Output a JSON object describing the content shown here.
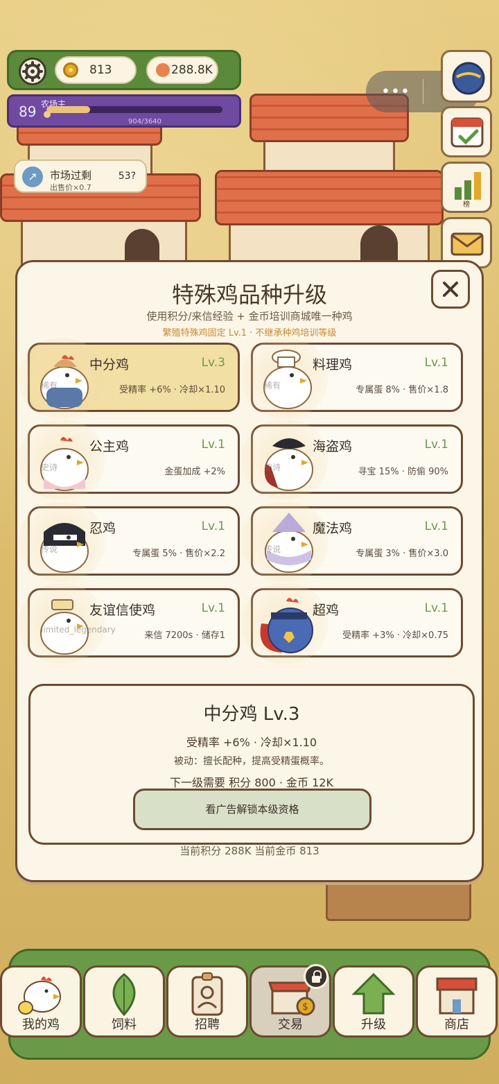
{
  "hud": {
    "coins": "813",
    "seeds": "288.8K",
    "level": "89",
    "level_title": "农场主",
    "xp_text": "904/3640",
    "xp_fraction": 0.248
  },
  "market": {
    "title": "市场过剩",
    "sub": "出售价×0.7",
    "count": "53?"
  },
  "side": {
    "rank_label": "榜"
  },
  "modal": {
    "title": "特殊鸡品种升级",
    "subtitle": "使用积分/来信经验 + 金币培训商城唯一种鸡",
    "note": "繁殖特殊鸡固定 Lv.1 · 不继承种鸡培训等级",
    "cards": [
      {
        "name": "中分鸡",
        "lv": "Lv.3",
        "stats": "受精率 +6% · 冷却×1.10",
        "tag": "稀有"
      },
      {
        "name": "料理鸡",
        "lv": "Lv.1",
        "stats": "专属蛋 8% · 售价×1.8",
        "tag": "稀有"
      },
      {
        "name": "公主鸡",
        "lv": "Lv.1",
        "stats": "金蛋加成 +2%",
        "tag": "史诗"
      },
      {
        "name": "海盗鸡",
        "lv": "Lv.1",
        "stats": "寻宝 15% · 防偷 90%",
        "tag": "史诗"
      },
      {
        "name": "忍鸡",
        "lv": "Lv.1",
        "stats": "专属蛋 5% · 售价×2.2",
        "tag": "传说"
      },
      {
        "name": "魔法鸡",
        "lv": "Lv.1",
        "stats": "专属蛋 3% · 售价×3.0",
        "tag": "传说"
      },
      {
        "name": "友谊信使鸡",
        "lv": "Lv.1",
        "stats": "来信 7200s · 储存1",
        "tag": "limited_legendary"
      },
      {
        "name": "超鸡",
        "lv": "Lv.1",
        "stats": "受精率 +3% · 冷却×0.75",
        "tag": ""
      }
    ],
    "detail": {
      "title": "中分鸡  Lv.3",
      "stats": "受精率 +6% · 冷却×1.10",
      "passive": "被动：擅长配种，提高受精蛋概率。",
      "next": "下一级需要  积分 800  ·  金币 12K",
      "ad_button": "看广告解锁本级资格"
    },
    "balance": "当前积分 288K   当前金币 813"
  },
  "nav": [
    {
      "label": "我的鸡"
    },
    {
      "label": "饲料"
    },
    {
      "label": "招聘"
    },
    {
      "label": "交易"
    },
    {
      "label": "升级"
    },
    {
      "label": "商店"
    }
  ],
  "colors": {
    "accent_green": "#6a9a48",
    "level_purple": "#6f4aa0",
    "note_orange": "#c98a30",
    "selected_card": "#f1dfa4"
  }
}
